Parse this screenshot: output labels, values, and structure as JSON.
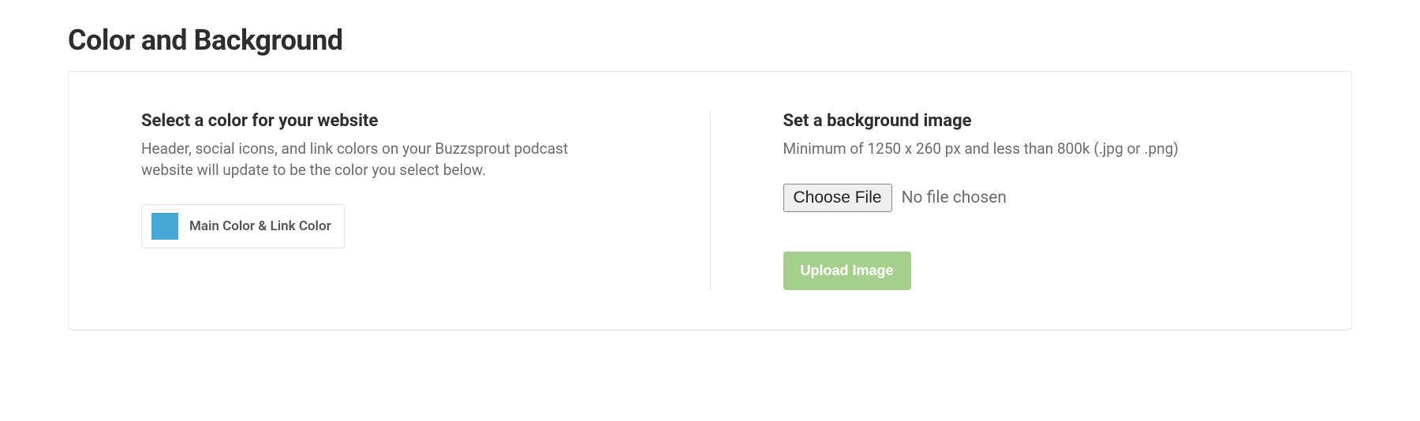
{
  "page": {
    "title": "Color and Background"
  },
  "color_section": {
    "heading": "Select a color for your website",
    "description": "Header, social icons, and link colors on your Buzzsprout podcast website will update to be the color you select below.",
    "swatch_color": "#46a8d8",
    "swatch_label": "Main Color & Link Color"
  },
  "background_section": {
    "heading": "Set a background image",
    "description": "Minimum of 1250 x 260 px and less than 800k (.jpg or .png)",
    "choose_file_label": "Choose File",
    "file_status": "No file chosen",
    "upload_button_label": "Upload Image"
  }
}
